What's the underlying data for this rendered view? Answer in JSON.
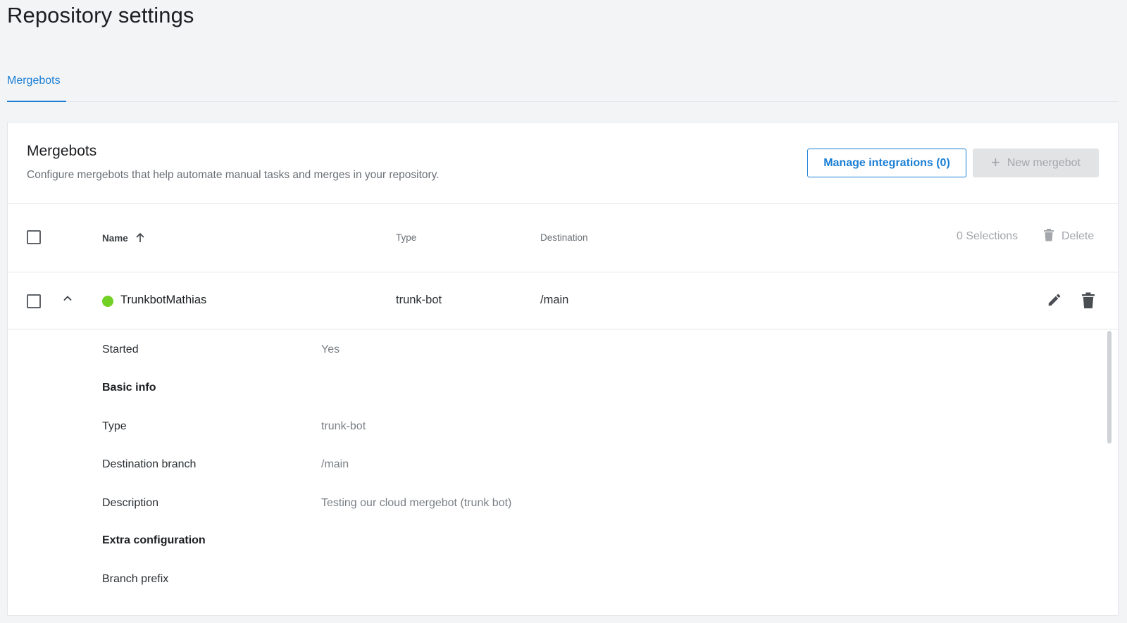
{
  "page": {
    "title": "Repository settings"
  },
  "tabs": [
    {
      "label": "Mergebots",
      "active": true
    }
  ],
  "card": {
    "title": "Mergebots",
    "description": "Configure mergebots that help automate manual tasks and merges in your repository.",
    "manage_button": "Manage integrations (0)",
    "new_button": "New mergebot"
  },
  "table": {
    "columns": {
      "name": "Name",
      "type": "Type",
      "destination": "Destination"
    },
    "selections": "0 Selections",
    "delete_label": "Delete",
    "rows": [
      {
        "name": "TrunkbotMathias",
        "type": "trunk-bot",
        "destination": "/main",
        "status_color": "#73d126"
      }
    ]
  },
  "details": {
    "started_label": "Started",
    "started_value": "Yes",
    "basic_info": "Basic info",
    "type_label": "Type",
    "type_value": "trunk-bot",
    "destination_label": "Destination branch",
    "destination_value": "/main",
    "description_label": "Description",
    "description_value": "Testing our cloud mergebot (trunk bot)",
    "extra_config": "Extra configuration",
    "branch_prefix_label": "Branch prefix"
  },
  "colors": {
    "accent": "#1a7fd4",
    "status_running": "#73d126"
  }
}
